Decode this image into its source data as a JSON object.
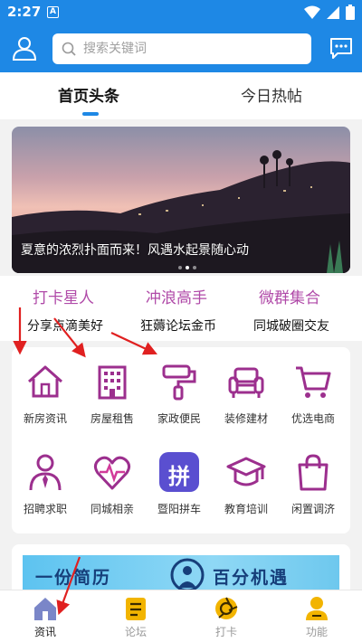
{
  "status_bar": {
    "time": "2:27",
    "notif_badge": "A"
  },
  "search": {
    "placeholder": "搜索关键词"
  },
  "tabs": [
    {
      "label": "首页头条",
      "active": true
    },
    {
      "label": "今日热帖",
      "active": false
    }
  ],
  "banner": {
    "caption": "夏意的浓烈扑面而来！风遇水起景随心动",
    "dot_count": 3,
    "active_dot": 1
  },
  "promos": [
    {
      "title": "打卡星人",
      "subtitle": "分享点滴美好"
    },
    {
      "title": "冲浪高手",
      "subtitle": "狂薅论坛金币"
    },
    {
      "title": "微群集合",
      "subtitle": "同城破圈交友"
    }
  ],
  "services": [
    {
      "label": "新房资讯",
      "icon": "house-icon"
    },
    {
      "label": "房屋租售",
      "icon": "building-icon"
    },
    {
      "label": "家政便民",
      "icon": "paint-roller-icon"
    },
    {
      "label": "装修建材",
      "icon": "sofa-icon"
    },
    {
      "label": "优选电商",
      "icon": "cart-icon"
    },
    {
      "label": "招聘求职",
      "icon": "person-tie-icon"
    },
    {
      "label": "同城相亲",
      "icon": "heart-pulse-icon"
    },
    {
      "label": "暨阳拼车",
      "icon": "pin-badge-icon",
      "badge_text": "拼"
    },
    {
      "label": "教育培训",
      "icon": "graduation-cap-icon"
    },
    {
      "label": "闲置调济",
      "icon": "shopping-bag-icon"
    }
  ],
  "ad": {
    "text_left": "一份简历",
    "text_right": "百分机遇"
  },
  "bottom_nav": [
    {
      "label": "资讯",
      "icon": "home-icon",
      "active": true
    },
    {
      "label": "论坛",
      "icon": "forum-icon",
      "active": false
    },
    {
      "label": "打卡",
      "icon": "camera-shutter-icon",
      "active": false
    },
    {
      "label": "功能",
      "icon": "user-functions-icon",
      "active": false
    }
  ],
  "colors": {
    "primary": "#1e88e5",
    "purple": "#b04aa8",
    "icon_purple": "#9c2f8e",
    "nav_gold": "#f2b400",
    "annotation_red": "#e02020"
  }
}
